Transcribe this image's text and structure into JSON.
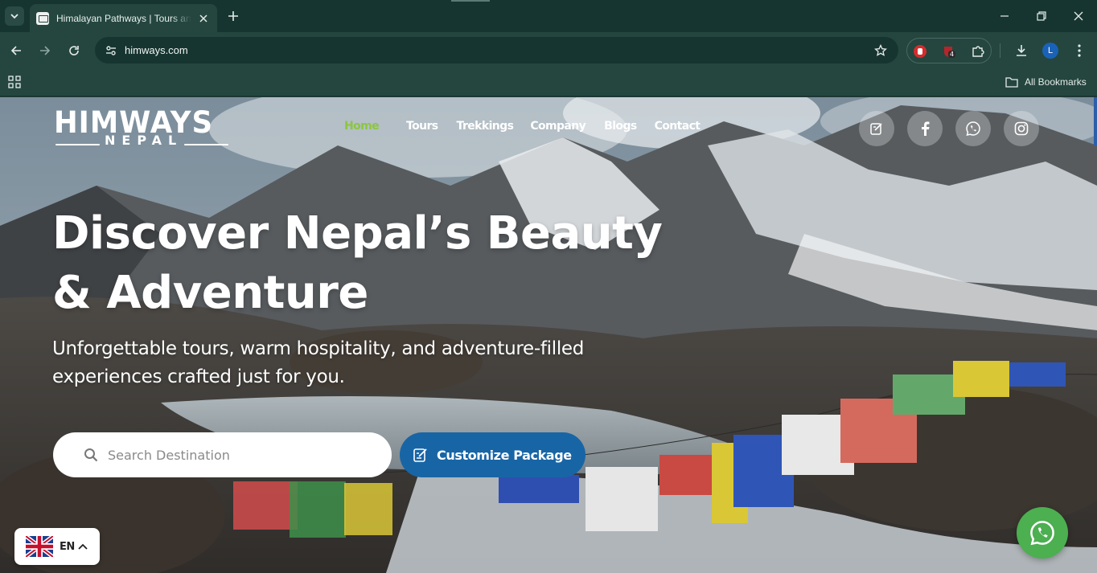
{
  "browser": {
    "tab_title": "Himalayan Pathways | Tours and Treks in Nepal",
    "url": "himways.com",
    "extension_badge": "4",
    "profile_initial": "L",
    "bookmarks_label": "All Bookmarks"
  },
  "site": {
    "logo_main": "HIMWAYS",
    "logo_sub": "NEPAL",
    "nav": [
      {
        "label": "Home",
        "active": true
      },
      {
        "label": "Tours"
      },
      {
        "label": "Trekkings"
      },
      {
        "label": "Company"
      },
      {
        "label": "Blogs"
      },
      {
        "label": "Contact"
      }
    ],
    "social": [
      "edit-icon",
      "facebook-icon",
      "whatsapp-icon",
      "instagram-icon"
    ]
  },
  "hero": {
    "title_line1": "Discover Nepal’s Beauty",
    "title_line2": "& Adventure",
    "subtitle_line1": "Unforgettable tours, warm hospitality, and adventure-filled",
    "subtitle_line2": "experiences crafted just for you."
  },
  "search": {
    "placeholder": "Search Destination"
  },
  "cta": {
    "customize_label": "Customize Package"
  },
  "language": {
    "code": "EN"
  },
  "colors": {
    "accent_green": "#8cc63f",
    "cta_blue": "#1865a6",
    "whatsapp_green": "#4caf50"
  }
}
